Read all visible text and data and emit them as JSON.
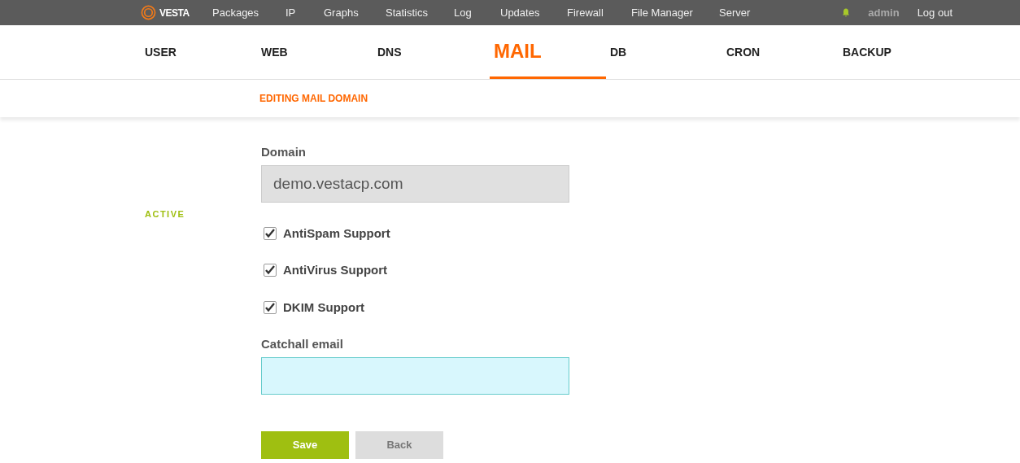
{
  "top_menu": {
    "logo": "VESTA",
    "items": [
      {
        "label": "Packages"
      },
      {
        "label": "IP"
      },
      {
        "label": "Graphs"
      },
      {
        "label": "Statistics"
      },
      {
        "label": "Log"
      },
      {
        "label": "Updates"
      },
      {
        "label": "Firewall"
      },
      {
        "label": "File Manager"
      },
      {
        "label": "Server"
      }
    ],
    "user": "admin",
    "logout": "Log out"
  },
  "tabs": [
    {
      "label": "USER",
      "selected": false
    },
    {
      "label": "WEB",
      "selected": false
    },
    {
      "label": "DNS",
      "selected": false
    },
    {
      "label": "MAIL",
      "selected": true
    },
    {
      "label": "DB",
      "selected": false
    },
    {
      "label": "CRON",
      "selected": false
    },
    {
      "label": "BACKUP",
      "selected": false
    }
  ],
  "breadcrumb": "EDITING MAIL DOMAIN",
  "status": "ACTIVE",
  "form": {
    "domain_label": "Domain",
    "domain_value": "demo.vestacp.com",
    "options": [
      {
        "label": "AntiSpam Support",
        "checked": true
      },
      {
        "label": "AntiVirus Support",
        "checked": true
      },
      {
        "label": "DKIM Support",
        "checked": true
      }
    ],
    "catchall_label": "Catchall email"
  },
  "buttons": [
    {
      "label": "Save",
      "kind": "primary"
    },
    {
      "label": "Back",
      "kind": "secondary"
    }
  ]
}
